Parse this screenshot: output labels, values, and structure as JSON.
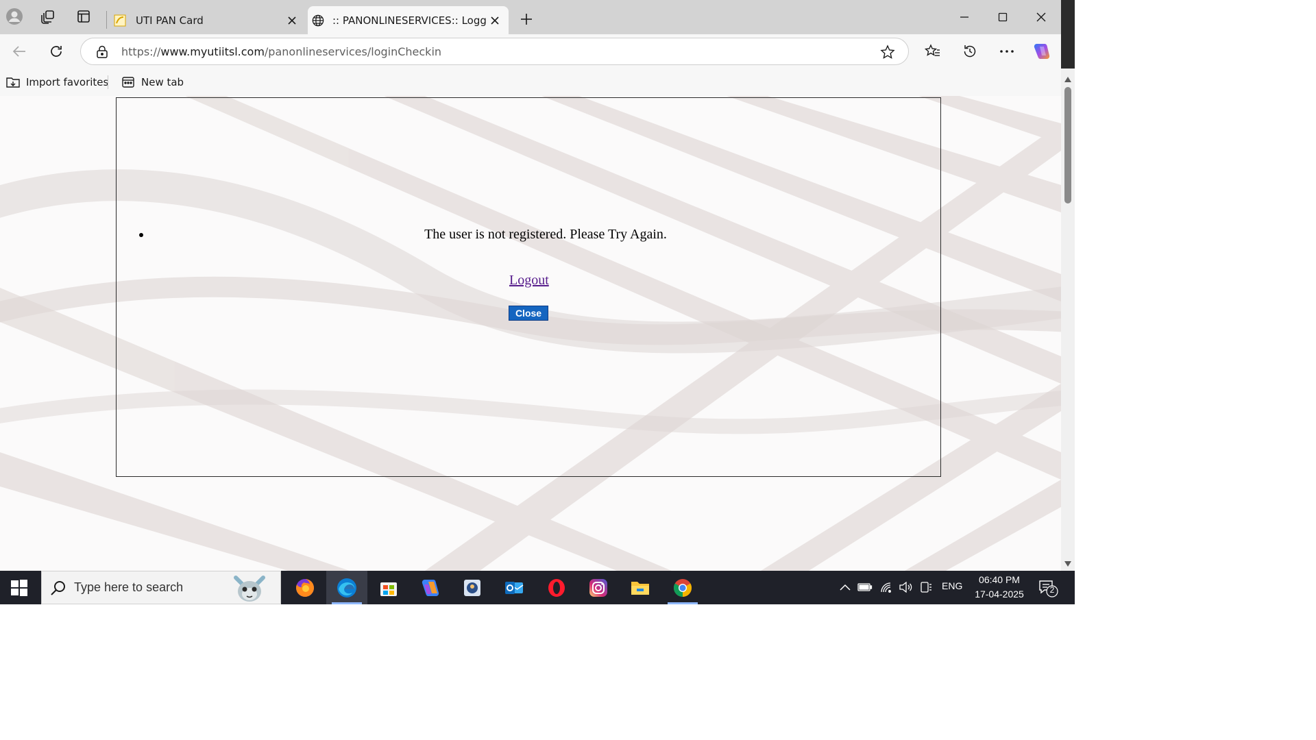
{
  "browser": {
    "tabs": [
      {
        "title": "UTI PAN Card",
        "active": false
      },
      {
        "title": ":: PANONLINESERVICES:: Logged Out",
        "active": true
      }
    ],
    "address": {
      "scheme": "https://",
      "host": "www.myutiitsl.com",
      "path": "/panonlineservices/loginCheckin"
    },
    "favorites": [
      {
        "label": "Import favorites",
        "icon": "import-favorites-icon"
      },
      {
        "label": "New tab",
        "icon": "new-tab-icon"
      }
    ]
  },
  "page": {
    "message": "The user is not registered. Please Try Again.",
    "logout_label": "Logout",
    "close_label": "Close"
  },
  "taskbar": {
    "search_placeholder": "Type here to search",
    "language": "ENG",
    "time": "06:40 PM",
    "date": "17-04-2025",
    "notification_count": "2",
    "apps": [
      "firefox-icon",
      "edge-icon",
      "store-icon",
      "copilot-icon",
      "app-icon",
      "outlook-icon",
      "opera-icon",
      "instagram-icon",
      "file-explorer-icon",
      "chrome-icon"
    ]
  },
  "colors": {
    "close_button": "#1565c0",
    "logout_link": "#551a8b",
    "taskbar": "#1f2129"
  }
}
